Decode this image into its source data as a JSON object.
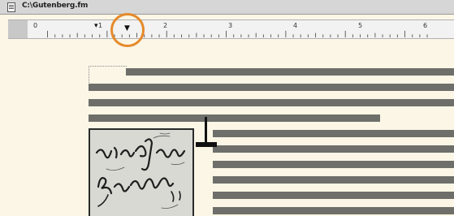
{
  "window": {
    "title": "C:\\Gutenberg.fm",
    "title_icon": "document-icon"
  },
  "ruler": {
    "numbers": [
      "0",
      "1",
      "2",
      "3",
      "4",
      "5",
      "6"
    ],
    "tab_stop_icon": "tab-stop-icon",
    "highlight_color": "#e58a2a"
  },
  "document": {
    "background": "#fbf6e6",
    "line_color": "#6e6e6a",
    "image": {
      "kind": "handwritten calligraphy sample",
      "icon": "calligraphy-image"
    },
    "cursor_icon": "text-insertion-cursor-icon"
  }
}
